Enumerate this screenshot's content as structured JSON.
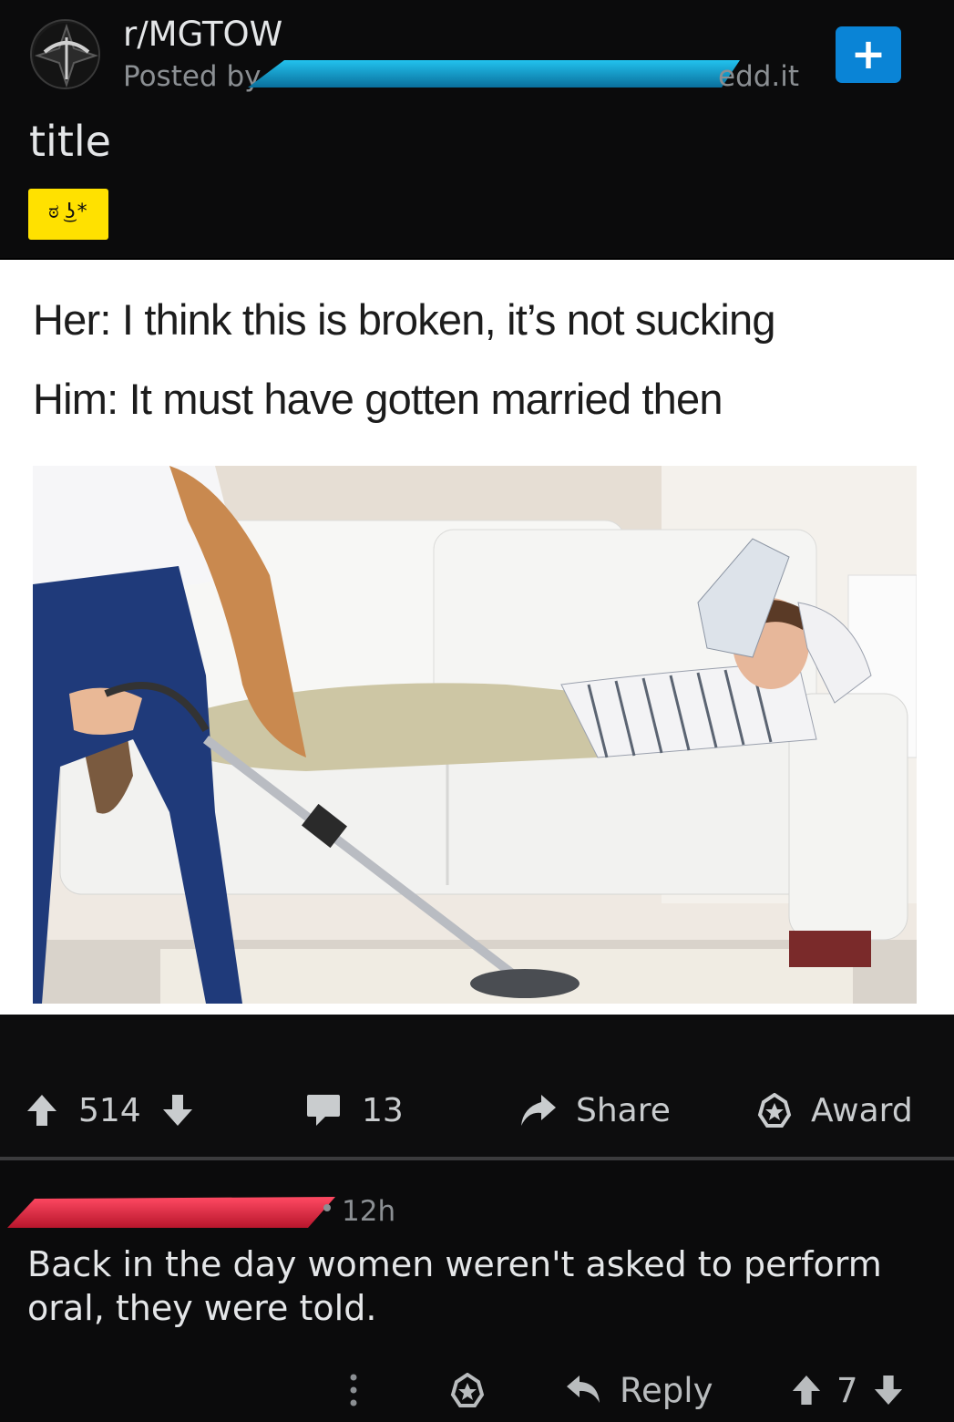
{
  "post": {
    "subreddit": "r/MGTOW",
    "posted_by_label": "Posted by",
    "username_suffix": "edd.it",
    "join_symbol": "+",
    "title": "title",
    "flair": "ಠ ͜ʖ*"
  },
  "meme": {
    "caption_line_1": "Her: I think this is broken, it’s not sucking",
    "caption_line_2": "Him: It must have gotten married then"
  },
  "actions": {
    "score": "514",
    "comments": "13",
    "share_label": "Share",
    "award_label": "Award"
  },
  "comment": {
    "time": "12h",
    "body": "Back in the day women weren't asked to perform oral, they were told.",
    "reply_label": "Reply",
    "score": "7"
  },
  "colors": {
    "username_redaction": "#1aa3d4",
    "commenter_redaction": "#e8304a",
    "join_button": "#0a84d6",
    "flair_bg": "#ffe100"
  },
  "icons": [
    "subreddit-avatar-icon",
    "plus-icon",
    "upvote-icon",
    "downvote-icon",
    "comment-icon",
    "share-icon",
    "award-icon",
    "more-options-icon",
    "reply-icon"
  ]
}
